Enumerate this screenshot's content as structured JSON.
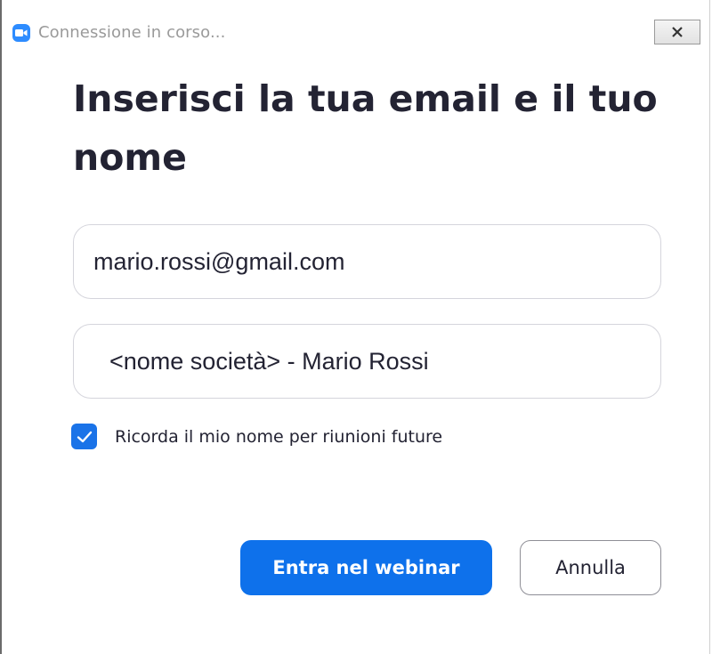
{
  "window": {
    "title": "Connessione in corso...",
    "app_icon": "zoom-camera-icon",
    "close_icon": "close-icon"
  },
  "form": {
    "heading": "Inserisci la tua email e il tuo nome",
    "email_value": "mario.rossi@gmail.com",
    "name_value": "<nome società> - Mario Rossi",
    "remember_label": "Ricorda il mio nome per riunioni future",
    "remember_checked": true
  },
  "actions": {
    "join_label": "Entra nel webinar",
    "cancel_label": "Annulla"
  },
  "colors": {
    "accent": "#0e71eb",
    "checkbox": "#1a73e8",
    "app_icon": "#2d8cff",
    "text": "#232333"
  }
}
